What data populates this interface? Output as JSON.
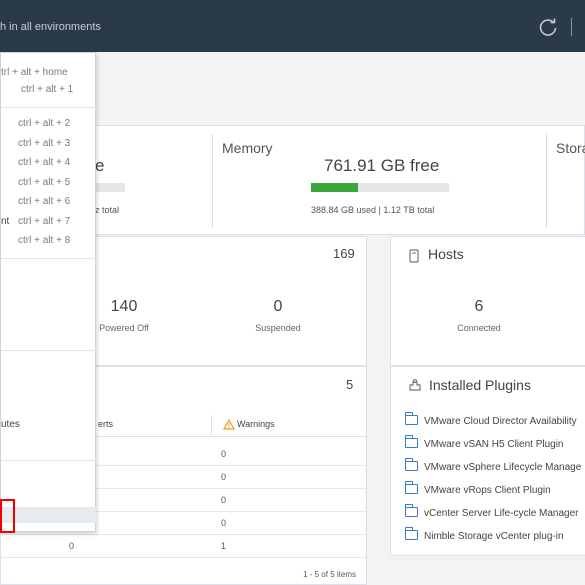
{
  "header": {
    "search_placeholder": "h in all environments",
    "refresh_icon": "refresh-icon"
  },
  "menu": {
    "shortcuts": [
      "trl + alt + home",
      "ctrl + alt + 1",
      "ctrl + alt + 2",
      "ctrl + alt + 3",
      "ctrl + alt + 4",
      "ctrl + alt + 5",
      "ctrl + alt + 6",
      "ctrl + alt + 7",
      "ctrl + alt + 8"
    ],
    "partial_label_7": "nt",
    "partial_label_utes": "utes"
  },
  "summary": {
    "cpu_partial_free": "e",
    "cpu_partial_total": "z total",
    "memory_title": "Memory",
    "memory_free": "761.91 GB free",
    "memory_used_fraction": 0.34,
    "memory_detail": "388.84 GB used | 1.12 TB total",
    "storage_partial_title": "Stora"
  },
  "vms": {
    "total": "169",
    "powered_off_count": "140",
    "powered_off_label": "Powered Off",
    "suspended_count": "0",
    "suspended_label": "Suspended"
  },
  "hosts": {
    "title": "Hosts",
    "connected_count": "6",
    "connected_label": "Connected"
  },
  "alarms": {
    "total": "5",
    "col_partial": "erts",
    "col_warnings": "Warnings",
    "rows": [
      {
        "c1": "",
        "c2": "0"
      },
      {
        "c1": "",
        "c2": "0"
      },
      {
        "c1": "",
        "c2": "0"
      },
      {
        "c1": "",
        "c2": "0"
      },
      {
        "c1": "0",
        "c2": "1"
      }
    ],
    "footer": "1 - 5 of 5 items"
  },
  "plugins": {
    "title": "Installed Plugins",
    "items": [
      "VMware Cloud Director Availability",
      "VMware vSAN H5 Client Plugin",
      "VMware vSphere Lifecycle Manage",
      "VMware vRops Client Plugin",
      "vCenter Server Life-cycle Manager",
      "Nimble Storage vCenter plug-in"
    ]
  },
  "colors": {
    "header_bg": "#2b3a4a",
    "usage_bar": "#3aa63a",
    "link_icon": "#3a7dc4",
    "warning": "#e8a21b",
    "highlight_border": "#e00000"
  }
}
